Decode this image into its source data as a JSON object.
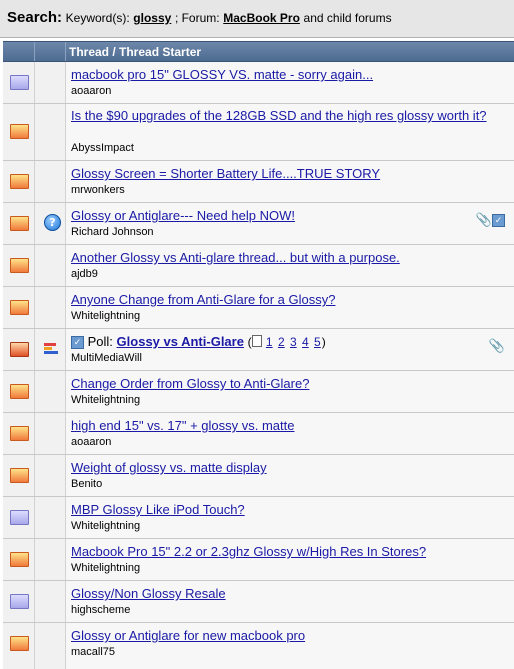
{
  "search": {
    "label": "Search:",
    "keyword_prefix": "Keyword(s):",
    "keyword": "glossy",
    "separator": "; Forum:",
    "forum": "MacBook Pro",
    "suffix": "and child forums"
  },
  "table": {
    "header": "Thread / Thread Starter"
  },
  "threads": [
    {
      "title": "macbook pro 15\" GLOSSY VS. matte - sorry again...",
      "starter": "aoaaron"
    },
    {
      "title": "Is the $90 upgrades of the 128GB SSD and the high res glossy worth it?",
      "starter": "AbyssImpact"
    },
    {
      "title": "Glossy Screen = Shorter Battery Life....TRUE STORY",
      "starter": "mrwonkers"
    },
    {
      "title": "Glossy or Antiglare--- Need help NOW!",
      "starter": "Richard Johnson"
    },
    {
      "title": "Another Glossy vs Anti-glare thread... but with a purpose.",
      "starter": "ajdb9"
    },
    {
      "title": "Anyone Change from Anti-Glare for a Glossy?",
      "starter": "Whitelightning"
    },
    {
      "poll_label": "Poll:",
      "title": "Glossy vs Anti-Glare",
      "pages": [
        "1",
        "2",
        "3",
        "4",
        "5"
      ],
      "starter": "MultiMediaWill"
    },
    {
      "title": "Change Order from Glossy to Anti-Glare?",
      "starter": "Whitelightning"
    },
    {
      "title": "high end 15\" vs. 17\" + glossy vs. matte",
      "starter": "aoaaron"
    },
    {
      "title": "Weight of glossy vs. matte display",
      "starter": "Benito"
    },
    {
      "title": "MBP Glossy Like iPod Touch?",
      "starter": "Whitelightning"
    },
    {
      "title": "Macbook Pro 15\" 2.2 or 2.3ghz Glossy w/High Res In Stores?",
      "starter": "Whitelightning"
    },
    {
      "title": "Glossy/Non Glossy Resale",
      "starter": "highscheme"
    },
    {
      "title": "Glossy or Antiglare for new macbook pro",
      "starter": "macall75"
    }
  ],
  "colors": {
    "link": "#1a1aa6",
    "header_bg": "#5a7aa0"
  }
}
